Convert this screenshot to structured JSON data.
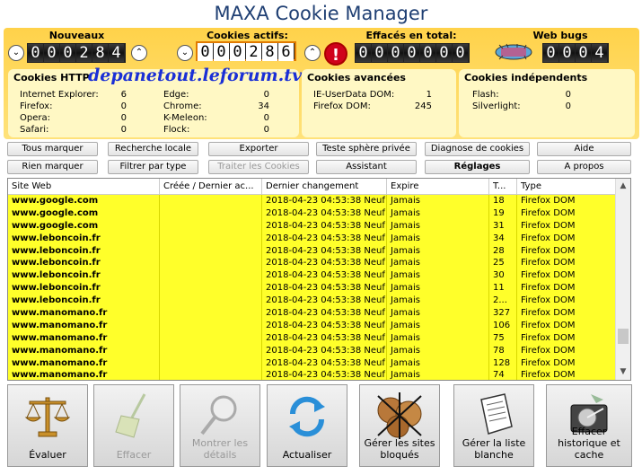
{
  "app_title": "MAXA Cookie Manager",
  "counters": {
    "nouveaux": {
      "label": "Nouveaux Cookies:",
      "value": "000284"
    },
    "actifs": {
      "label": "Cookies actifs:",
      "value": "000286"
    },
    "effaces": {
      "label": "Effacés en total:",
      "value": "0000000"
    },
    "webbugs": {
      "label": "Web bugs actifs:",
      "value": "0004"
    }
  },
  "watermark": "depanetout.leforum.tv",
  "http": {
    "title": "Cookies HTTP",
    "left": [
      [
        "Internet Explorer:",
        "6"
      ],
      [
        "Firefox:",
        "0"
      ],
      [
        "Opera:",
        "0"
      ],
      [
        "Safari:",
        "0"
      ]
    ],
    "right": [
      [
        "Edge:",
        "0"
      ],
      [
        "Chrome:",
        "34"
      ],
      [
        "K-Meleon:",
        "0"
      ],
      [
        "Flock:",
        "0"
      ]
    ]
  },
  "avancees": {
    "title": "Cookies avancées",
    "items": [
      [
        "IE-UserData DOM:",
        "1"
      ],
      [
        "Firefox DOM:",
        "245"
      ]
    ]
  },
  "independants": {
    "title": "Cookies indépendents",
    "items": [
      [
        "Flash:",
        "0"
      ],
      [
        "Silverlight:",
        "0"
      ]
    ]
  },
  "buttons": {
    "tous_marquer": "Tous marquer",
    "recherche_locale": "Recherche locale",
    "exporter": "Exporter",
    "teste_sphere": "Teste sphère privée",
    "diagnose": "Diagnose de cookies",
    "aide": "Aide",
    "rien_marquer": "Rien marquer",
    "filtrer": "Filtrer par type",
    "traiter": "Traiter les Cookies",
    "assistant": "Assistant",
    "reglages": "Réglages",
    "apropos": "A propos"
  },
  "columns": [
    "Site Web",
    "Créée / Dernier ac...",
    "Dernier changement",
    "Expire",
    "T...",
    "Type"
  ],
  "rows": [
    [
      "www.google.com",
      "",
      "2018-04-23 04:53:38 Neuf",
      "Jamais",
      "18",
      "Firefox DOM"
    ],
    [
      "www.google.com",
      "",
      "2018-04-23 04:53:38 Neuf",
      "Jamais",
      "19",
      "Firefox DOM"
    ],
    [
      "www.google.com",
      "",
      "2018-04-23 04:53:38 Neuf",
      "Jamais",
      "31",
      "Firefox DOM"
    ],
    [
      "www.leboncoin.fr",
      "",
      "2018-04-23 04:53:38 Neuf",
      "Jamais",
      "34",
      "Firefox DOM"
    ],
    [
      "www.leboncoin.fr",
      "",
      "2018-04-23 04:53:38 Neuf",
      "Jamais",
      "28",
      "Firefox DOM"
    ],
    [
      "www.leboncoin.fr",
      "",
      "2018-04-23 04:53:38 Neuf",
      "Jamais",
      "25",
      "Firefox DOM"
    ],
    [
      "www.leboncoin.fr",
      "",
      "2018-04-23 04:53:38 Neuf",
      "Jamais",
      "30",
      "Firefox DOM"
    ],
    [
      "www.leboncoin.fr",
      "",
      "2018-04-23 04:53:38 Neuf",
      "Jamais",
      "11",
      "Firefox DOM"
    ],
    [
      "www.leboncoin.fr",
      "",
      "2018-04-23 04:53:38 Neuf",
      "Jamais",
      "2...",
      "Firefox DOM"
    ],
    [
      "www.manomano.fr",
      "",
      "2018-04-23 04:53:38 Neuf",
      "Jamais",
      "327",
      "Firefox DOM"
    ],
    [
      "www.manomano.fr",
      "",
      "2018-04-23 04:53:38 Neuf",
      "Jamais",
      "106",
      "Firefox DOM"
    ],
    [
      "www.manomano.fr",
      "",
      "2018-04-23 04:53:38 Neuf",
      "Jamais",
      "75",
      "Firefox DOM"
    ],
    [
      "www.manomano.fr",
      "",
      "2018-04-23 04:53:38 Neuf",
      "Jamais",
      "78",
      "Firefox DOM"
    ],
    [
      "www.manomano.fr",
      "",
      "2018-04-23 04:53:38 Neuf",
      "Jamais",
      "128",
      "Firefox DOM"
    ],
    [
      "www.manomano.fr",
      "",
      "2018-04-23 04:53:38 Neuf",
      "Jamais",
      "74",
      "Firefox DOM"
    ]
  ],
  "actions": {
    "evaluer": "Évaluer",
    "effacer": "Effacer",
    "montrer": "Montrer les détails",
    "actualiser": "Actualiser",
    "gerer_bloques": "Gérer les sites bloqués",
    "gerer_blanche": "Gérer la liste blanche",
    "effacer_historique": "Effacer historique et cache"
  }
}
